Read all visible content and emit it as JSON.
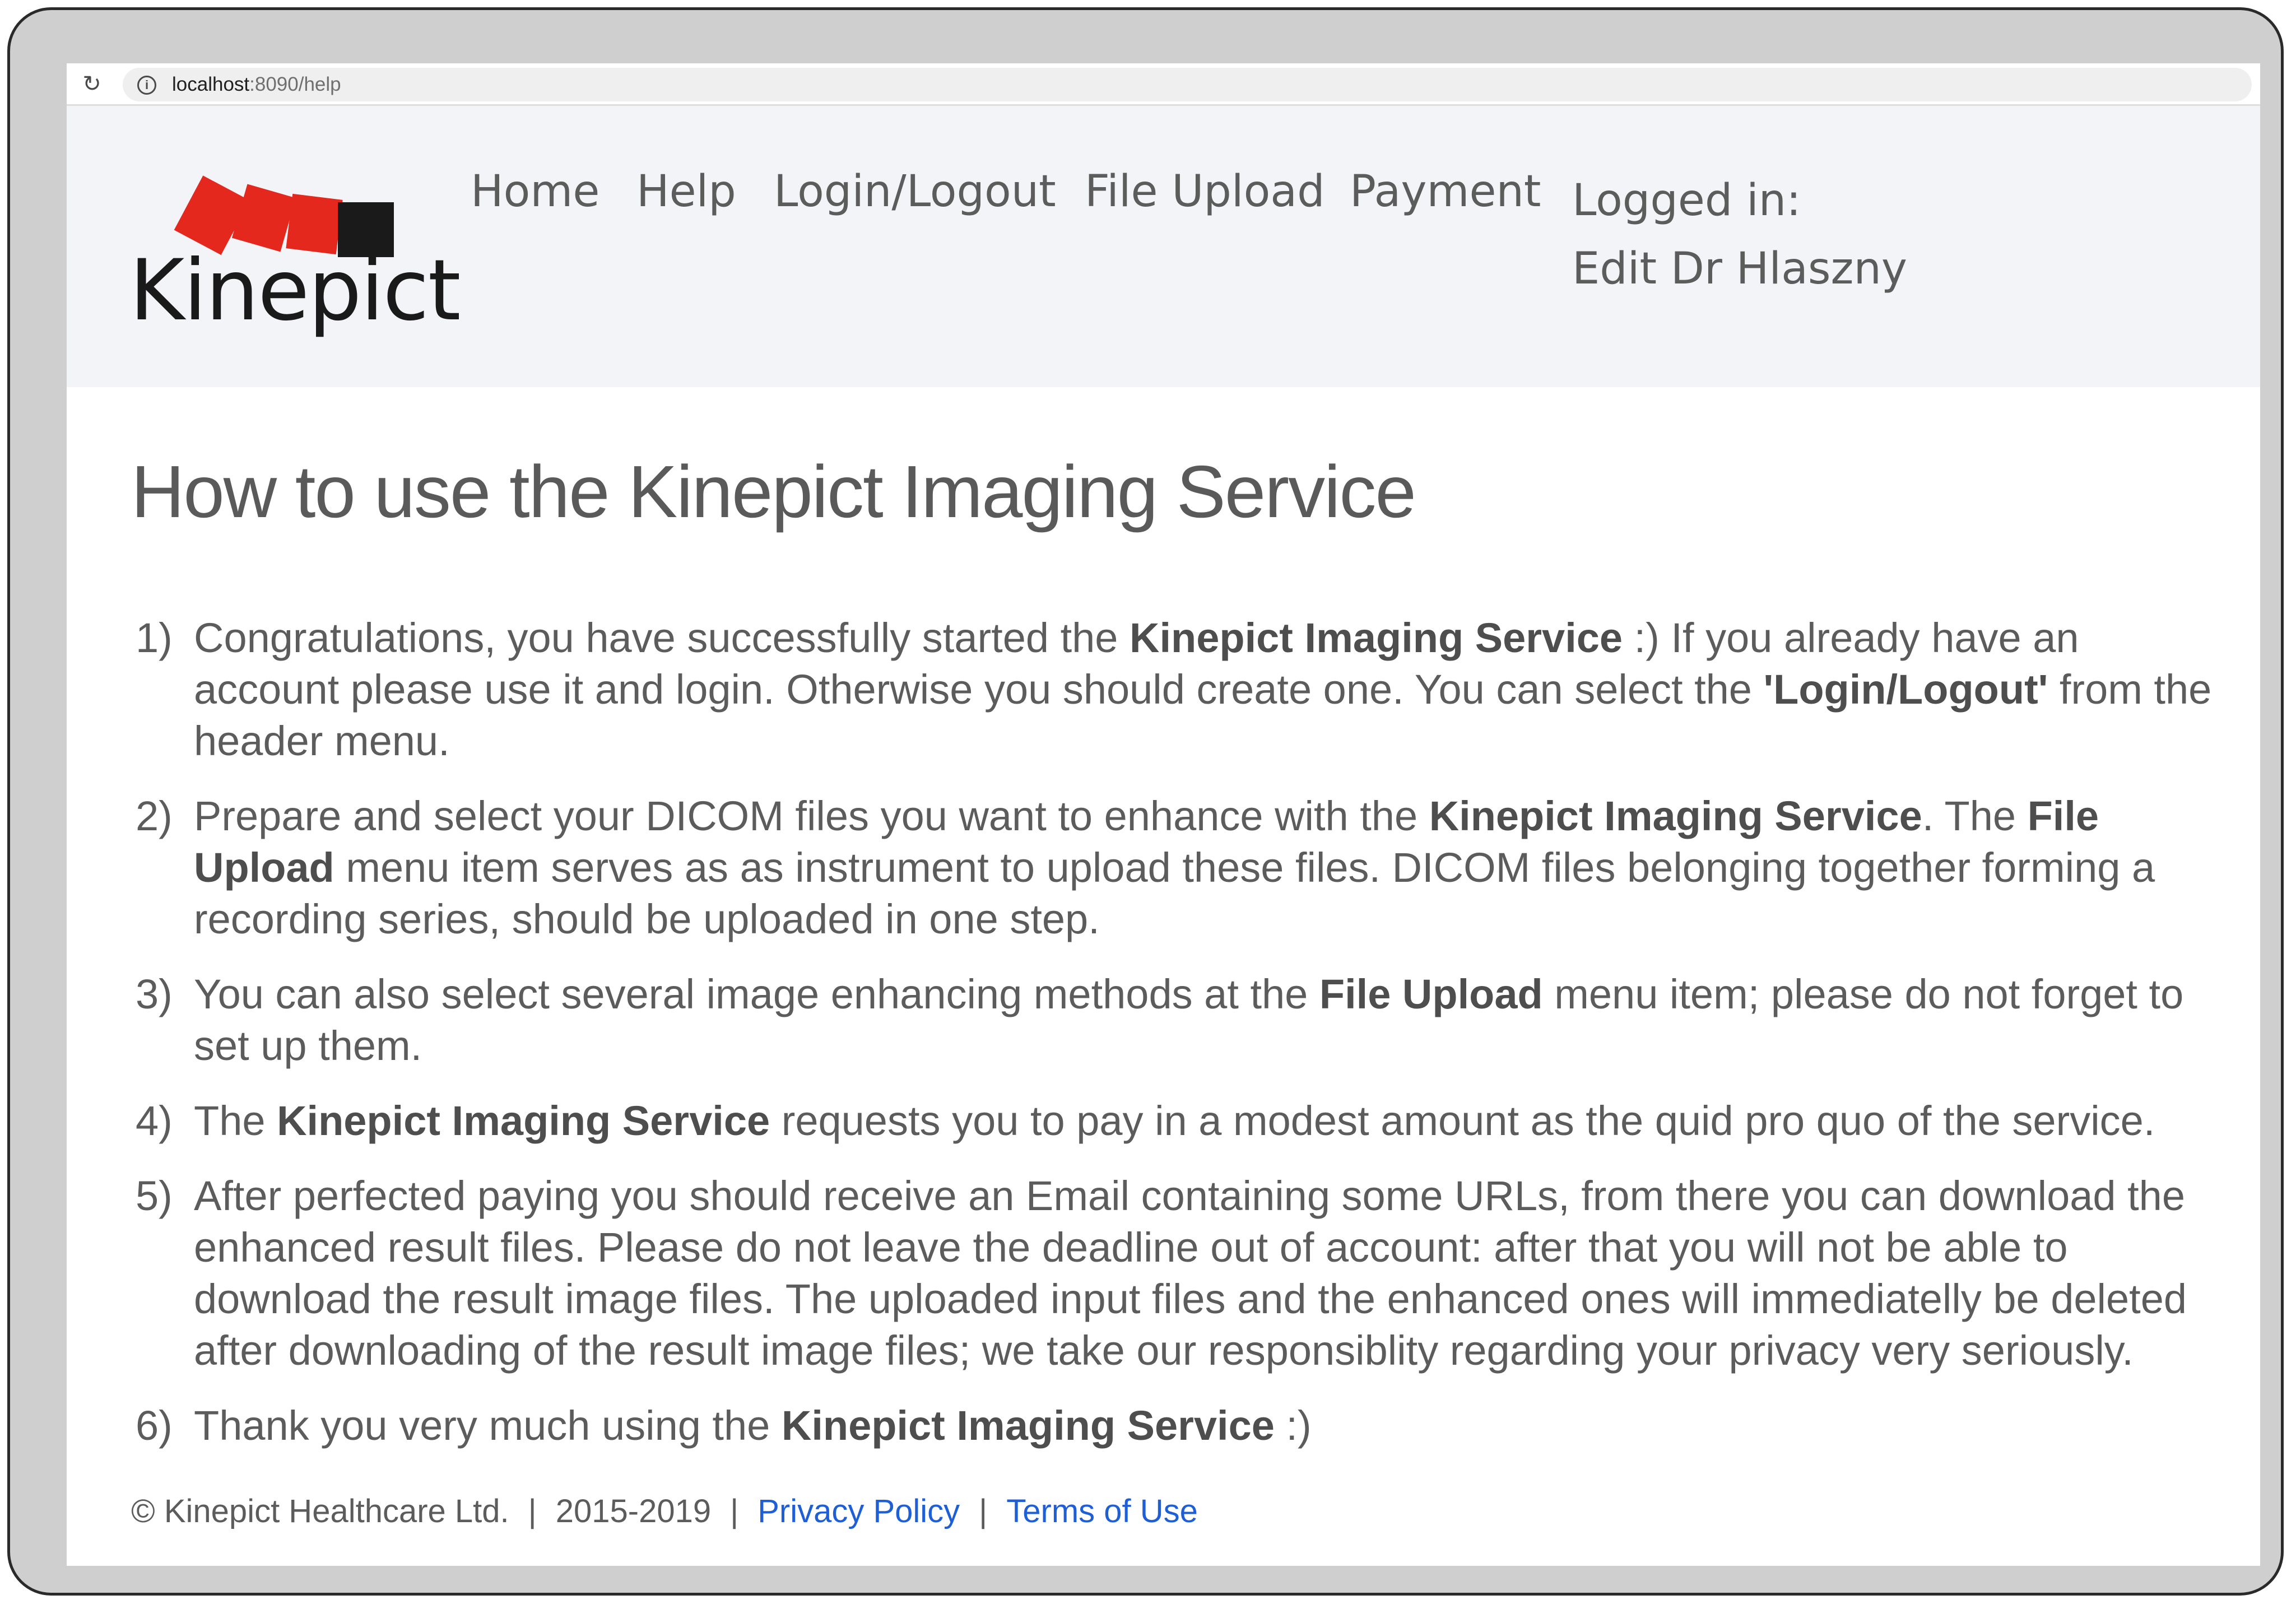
{
  "browser": {
    "reload_icon": "reload-icon",
    "info_icon": "info-icon",
    "url_host": "localhost",
    "url_path": ":8090/help"
  },
  "logo": {
    "text": "Kinepict",
    "colors": {
      "red": "#e4281e",
      "black": "#1a1a1a"
    }
  },
  "nav": {
    "home": "Home",
    "help": "Help",
    "login_logout": "Login/Logout",
    "file_upload": "File Upload",
    "payment": "Payment",
    "logged_in_label": "Logged in:",
    "logged_in_user": "Edit Dr Hlaszny"
  },
  "page": {
    "title": "How to use the Kinepict Imaging Service"
  },
  "steps": [
    {
      "num": "1)",
      "parts": [
        "Congratulations, you have successfully started the ",
        "Kinepict Imaging Service",
        " :) If you already have an account please use it and login. Otherwise you should create one. You can select the ",
        "'Login/Logout'",
        " from the header menu."
      ]
    },
    {
      "num": "2)",
      "parts": [
        "Prepare and select your DICOM files you want to enhance with the ",
        "Kinepict Imaging Service",
        ". The ",
        "File Upload",
        " menu item serves as as instrument to upload these files. DICOM files belonging together forming a recording series, should be uploaded in one step."
      ]
    },
    {
      "num": "3)",
      "parts": [
        "You can also select several image enhancing methods at the ",
        "File Upload",
        " menu item; please do not forget to set up them."
      ]
    },
    {
      "num": "4)",
      "parts": [
        "The ",
        "Kinepict Imaging Service",
        " requests you to pay in a modest amount as the quid pro quo of the service."
      ]
    },
    {
      "num": "5)",
      "parts": [
        "After perfected paying you should receive an Email containing some URLs, from there you can download the enhanced result files. Please do not leave the deadline out of account: after that you will not be able to download the result image files. The uploaded input files and the enhanced ones will immediatelly be deleted after downloading of the result image files; we take our responsiblity regarding your privacy very seriously."
      ]
    },
    {
      "num": "6)",
      "parts": [
        "Thank you very much using the ",
        "Kinepict Imaging Service",
        " :)"
      ]
    }
  ],
  "footer": {
    "copyright": "© Kinepict Healthcare Ltd.",
    "separator": "|",
    "years": "2015-2019",
    "privacy": "Privacy Policy",
    "terms": "Terms of Use",
    "link_color": "#1f5fd6"
  }
}
